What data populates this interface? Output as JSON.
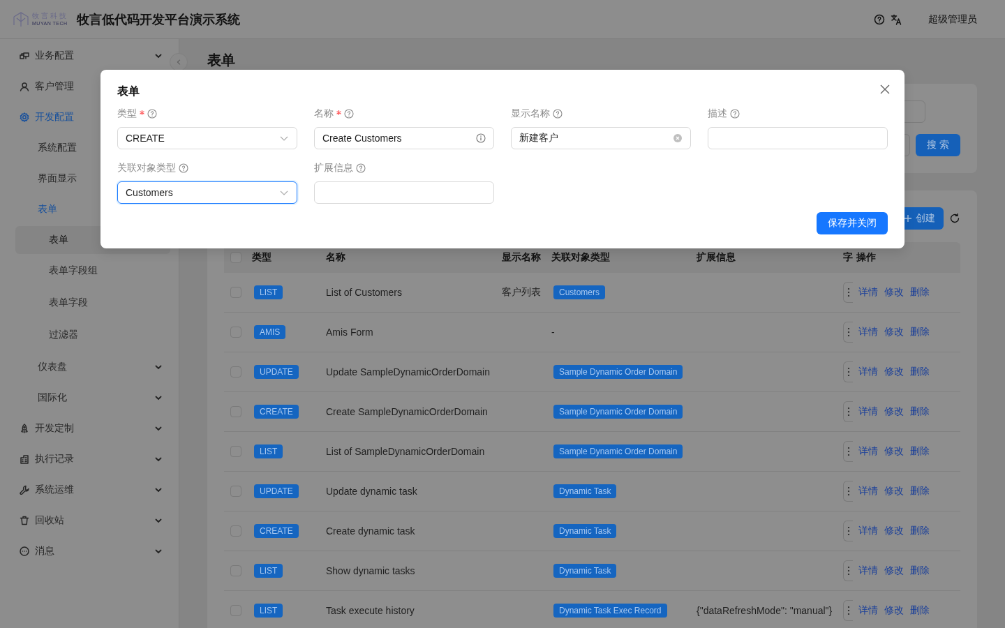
{
  "header": {
    "logo": {
      "name": "牧言科技",
      "tagline": "MUYAN TECH"
    },
    "title": "牧言低代码开发平台演示系统",
    "user": "超级管理员"
  },
  "sidebar": {
    "items": [
      {
        "label": "业务配置",
        "expanded": false,
        "selected": false
      },
      {
        "label": "客户管理",
        "selected": false
      },
      {
        "label": "开发配置",
        "expanded": true,
        "selected": true,
        "children": [
          {
            "label": "系统配置",
            "selected": false
          },
          {
            "label": "界面显示",
            "selected": false
          },
          {
            "label": "表单",
            "expanded": true,
            "selected": true,
            "children": [
              {
                "label": "表单",
                "selected": true
              },
              {
                "label": "表单字段组",
                "selected": false
              },
              {
                "label": "表单字段",
                "selected": false
              },
              {
                "label": "过滤器",
                "selected": false
              }
            ]
          },
          {
            "label": "仪表盘",
            "expanded": false,
            "selected": false
          },
          {
            "label": "国际化",
            "expanded": false,
            "selected": false
          }
        ]
      },
      {
        "label": "开发定制",
        "expanded": false,
        "selected": false
      },
      {
        "label": "执行记录",
        "expanded": false,
        "selected": false
      },
      {
        "label": "系统运维",
        "expanded": false,
        "selected": false
      },
      {
        "label": "回收站",
        "expanded": false,
        "selected": false
      },
      {
        "label": "消息",
        "expanded": false,
        "selected": false
      }
    ]
  },
  "page": {
    "title": "表单",
    "search_button": "搜 索",
    "create_button": "创建"
  },
  "table": {
    "all_selected": false,
    "columns": [
      "类型",
      "名称",
      "显示名称",
      "关联对象类型",
      "扩展信息",
      "字",
      "操作"
    ],
    "rows": [
      {
        "selected": false,
        "type": "LIST",
        "name": "List of Customers",
        "display_name": "客户列表",
        "object_type": {
          "kind": "tag",
          "label": "Customers"
        },
        "actions": [
          "详情",
          "修改",
          "删除"
        ]
      },
      {
        "selected": false,
        "type": "AMIS",
        "name": "Amis Form",
        "object_type": {
          "kind": "text",
          "label": "-"
        },
        "actions": [
          "详情",
          "修改",
          "删除"
        ]
      },
      {
        "selected": false,
        "type": "UPDATE",
        "name": "Update SampleDynamicOrderDomain",
        "object_type": {
          "kind": "tag",
          "label": "Sample Dynamic Order Domain"
        },
        "actions": [
          "详情",
          "修改",
          "删除"
        ]
      },
      {
        "selected": false,
        "type": "CREATE",
        "name": "Create SampleDynamicOrderDomain",
        "object_type": {
          "kind": "tag",
          "label": "Sample Dynamic Order Domain"
        },
        "actions": [
          "详情",
          "修改",
          "删除"
        ]
      },
      {
        "selected": false,
        "type": "LIST",
        "name": "List of SampleDynamicOrderDomain",
        "object_type": {
          "kind": "tag",
          "label": "Sample Dynamic Order Domain"
        },
        "actions": [
          "详情",
          "修改",
          "删除"
        ]
      },
      {
        "selected": false,
        "type": "UPDATE",
        "name": "Update dynamic task",
        "object_type": {
          "kind": "tag",
          "label": "Dynamic Task"
        },
        "actions": [
          "详情",
          "修改",
          "删除"
        ]
      },
      {
        "selected": false,
        "type": "CREATE",
        "name": "Create dynamic task",
        "object_type": {
          "kind": "tag",
          "label": "Dynamic Task"
        },
        "actions": [
          "详情",
          "修改",
          "删除"
        ]
      },
      {
        "selected": false,
        "type": "LIST",
        "name": "Show dynamic tasks",
        "object_type": {
          "kind": "tag",
          "label": "Dynamic Task"
        },
        "actions": [
          "详情",
          "修改",
          "删除"
        ]
      },
      {
        "selected": false,
        "type": "LIST",
        "name": "Task execute history",
        "object_type": {
          "kind": "tag",
          "label": "Dynamic Task Exec Record"
        },
        "extension": "{\"dataRefreshMode\": \"manual\"}",
        "actions": [
          "详情",
          "修改",
          "删除"
        ]
      }
    ]
  },
  "dialog": {
    "title": "表单",
    "fields": [
      {
        "label": "类型",
        "required": true,
        "kind": "select",
        "value": "CREATE",
        "focused": false,
        "info": false,
        "clearable": false
      },
      {
        "label": "名称",
        "required": true,
        "kind": "input",
        "value": "Create Customers",
        "focused": false,
        "info": true,
        "clearable": false
      },
      {
        "label": "显示名称",
        "required": false,
        "kind": "input",
        "value": "新建客户",
        "focused": false,
        "info": false,
        "clearable": true
      },
      {
        "label": "描述",
        "required": false,
        "kind": "input",
        "focused": false,
        "info": false,
        "clearable": false
      },
      {
        "label": "关联对象类型",
        "required": false,
        "kind": "select",
        "value": "Customers",
        "focused": true,
        "info": false,
        "clearable": false
      },
      {
        "label": "扩展信息",
        "required": false,
        "kind": "input",
        "focused": false,
        "info": false,
        "clearable": false
      }
    ],
    "save_button": "保存并关闭"
  }
}
